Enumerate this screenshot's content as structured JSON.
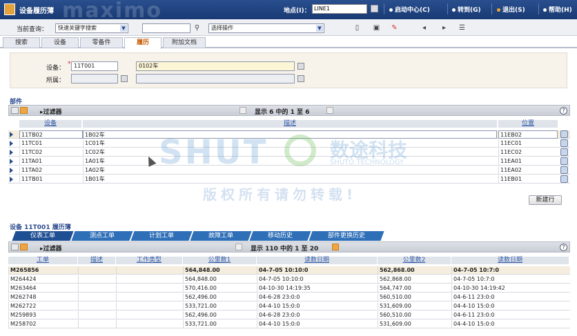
{
  "app": {
    "title": "设备履历薄",
    "brand": "maximo"
  },
  "topbar": {
    "location_label": "地点(I)：",
    "location_value": "LINE1",
    "links": [
      "启动中心(C)",
      "转到(G)",
      "退出(S)",
      "帮助(H)"
    ],
    "link_colors": [
      "#ffffff",
      "#ffffff",
      "#f3a633",
      "#ffffff"
    ]
  },
  "toolbar": {
    "query_label": "当前查询：",
    "query_value": "快速关键字搜索",
    "search_value": "",
    "action_label": "选择操作"
  },
  "tabs": [
    "搜索",
    "设备",
    "零备件",
    "履历",
    "附加文档"
  ],
  "active_tab": "履历",
  "form": {
    "device_label": "设备：",
    "device_value": "11T001",
    "device_desc": "0102车",
    "parent_label": "所属："
  },
  "parts": {
    "title": "部件",
    "filter_label": "过滤器",
    "pager": "显示 6 中的 1 至 6",
    "columns": [
      "设备",
      "描述",
      "位置"
    ],
    "rows": [
      {
        "device": "11TB02",
        "desc": "1B02车",
        "loc": "11EB02"
      },
      {
        "device": "11TC01",
        "desc": "1C01车",
        "loc": "11EC01"
      },
      {
        "device": "11TC02",
        "desc": "1C02车",
        "loc": "11EC02"
      },
      {
        "device": "11TA01",
        "desc": "1A01车",
        "loc": "11EA01"
      },
      {
        "device": "11TA02",
        "desc": "1A02车",
        "loc": "11EA02"
      },
      {
        "device": "11TB01",
        "desc": "1B01车",
        "loc": "11EB01"
      }
    ],
    "new_row_label": "新建行"
  },
  "history": {
    "title": "设备 11T001 履历薄",
    "subtabs": [
      "仪表工单",
      "测点工单",
      "计划工单",
      "故障工单",
      "移动历史",
      "部件更换历史"
    ],
    "filter_label": "过滤器",
    "pager": "显示 110 中的 1 至 20",
    "columns": [
      "工单",
      "描述",
      "工作类型",
      "公里数1",
      "读数日期",
      "公里数2",
      "读数日期"
    ],
    "rows": [
      [
        "M265856",
        "",
        "",
        "564,848.00",
        "04-7-05 10:10:0",
        "562,868.00",
        "04-7-05 10:7:0"
      ],
      [
        "M264424",
        "",
        "",
        "564,848.00",
        "04-7-05 10:10:0",
        "562,868.00",
        "04-7-05 10:7:0"
      ],
      [
        "M263464",
        "",
        "",
        "570,416.00",
        "04-10-30 14:19:35",
        "564,747.00",
        "04-10-30 14:19:42"
      ],
      [
        "M262748",
        "",
        "",
        "562,496.00",
        "04-6-28 23:0:0",
        "560,510.00",
        "04-6-11 23:0:0"
      ],
      [
        "M262722",
        "",
        "",
        "533,721.00",
        "04-4-10 15:0:0",
        "531,609.00",
        "04-4-10 15:0:0"
      ],
      [
        "M259893",
        "",
        "",
        "562,496.00",
        "04-6-28 23:0:0",
        "560,510.00",
        "04-6-11 23:0:0"
      ],
      [
        "M258702",
        "",
        "",
        "533,721.00",
        "04-4-10 15:0:0",
        "531,609.00",
        "04-4-10 15:0:0"
      ]
    ]
  },
  "watermark": {
    "brand": "SHUT",
    "cn": "数途科技",
    "en": "SHUTO TECHNOLOGY",
    "notice": "版权所有请勿转载!"
  }
}
